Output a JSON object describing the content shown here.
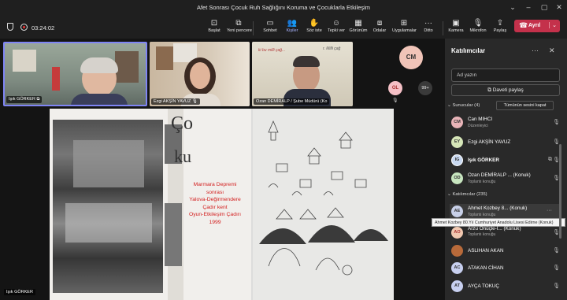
{
  "window": {
    "title": "Afet Sonrası Çocuk Ruh Sağlığını Koruma ve Çocuklarla Etkileşim"
  },
  "toolbar": {
    "timer": "03:24:02",
    "items": [
      {
        "label": "Başlat",
        "icon": "start-icon"
      },
      {
        "label": "Yeni pencere",
        "icon": "new-window-icon"
      },
      {
        "label": "Sohbet",
        "icon": "chat-icon"
      },
      {
        "label": "Kişiler",
        "icon": "people-icon"
      },
      {
        "label": "Söz iste",
        "icon": "raise-hand-icon"
      },
      {
        "label": "Tepki ver",
        "icon": "react-icon"
      },
      {
        "label": "Görünüm",
        "icon": "view-icon"
      },
      {
        "label": "Odalar",
        "icon": "rooms-icon"
      },
      {
        "label": "Uygulamalar",
        "icon": "apps-icon"
      },
      {
        "label": "Ditto",
        "icon": "more-icon"
      },
      {
        "label": "Kamera",
        "icon": "camera-icon"
      },
      {
        "label": "Mikrofon",
        "icon": "mic-icon"
      },
      {
        "label": "Paylaş",
        "icon": "share-icon"
      }
    ],
    "leave_label": "Ayrıl"
  },
  "videos": [
    {
      "name": "Işık GÖRKER"
    },
    {
      "name": "Ezgi AKŞİN YAVUZ"
    },
    {
      "name": "Ozan DEMİRALP / Şube Müdürü (Ko"
    }
  ],
  "avatars": {
    "cm": "CM",
    "ol": "OL",
    "more": "99+"
  },
  "share": {
    "caption_lines": [
      "Marmara Depremi",
      "sonrası",
      "Yalova-Değirmendere",
      "Çadır kent",
      "Oyun-Etkileşim Çadırı",
      "1999"
    ],
    "presenter": "Işık GÖRKER"
  },
  "panel": {
    "title": "Katılımcılar",
    "search_placeholder": "Ad yazın",
    "invite_label": "Daveti paylaş",
    "presenters_header": "Sunucular (4)",
    "mute_all_label": "Tümünün sesini kapat",
    "attendees_header": "Katılımcılar (235)",
    "presenters": [
      {
        "initials": "CM",
        "name": "Can MIHCI",
        "role": "Düzenleyici",
        "color": "#e8b4b8"
      },
      {
        "initials": "EY",
        "name": "Ezgi AKŞİN YAVUZ",
        "role": "",
        "color": "#d6e6b8"
      },
      {
        "initials": "IG",
        "name": "Işık GÖRKER",
        "role": "",
        "color": "#c8d8f0"
      },
      {
        "initials": "OD",
        "name": "Ozan DEMİRALP ... (Konuk)",
        "role": "Toplantı konuğu",
        "color": "#c8e6c0"
      }
    ],
    "attendees": [
      {
        "initials": "AE",
        "name": "Ahmet Kozbey 8... (Konuk)",
        "role": "Toplantı konuğu",
        "color": "#c8d0e8"
      },
      {
        "initials": "AO",
        "name": "Arzu Önüçle-İ... (Konuk)",
        "role": "Toplantı konuğu",
        "color": "#f0c8b0"
      },
      {
        "initials": "",
        "name": "ASLIHAN AKAN",
        "role": "",
        "color": "#b86a3a"
      },
      {
        "initials": "AC",
        "name": "ATAKAN CİHAN",
        "role": "",
        "color": "#c8d0f0"
      },
      {
        "initials": "AT",
        "name": "AYÇA TOKUÇ",
        "role": "",
        "color": "#c8d0f0"
      }
    ],
    "tooltip": "Ahmet Kozbey 80.Yıl Cumhuriyet Anadolu Lisesi Edirne (Konuk)"
  },
  "colors": {
    "leave": "#c4314b",
    "accent": "#a9b4ff"
  }
}
